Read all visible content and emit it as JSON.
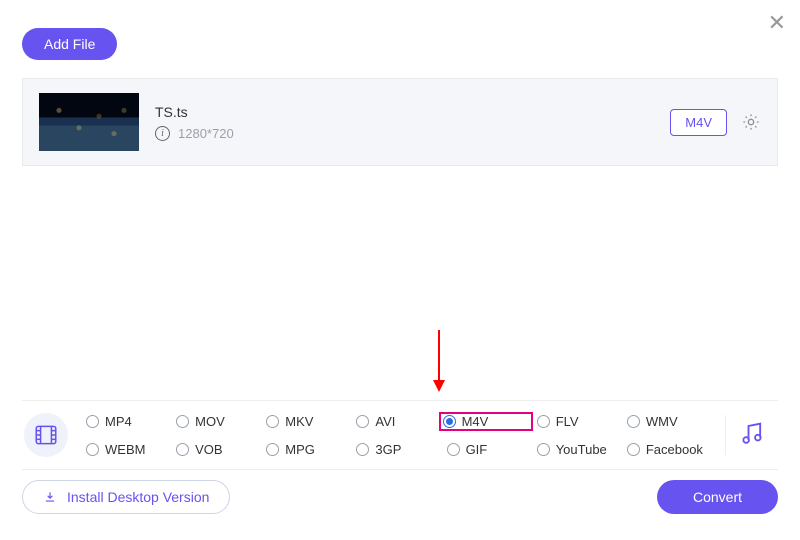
{
  "header": {
    "add_file_label": "Add File"
  },
  "file": {
    "name": "TS.ts",
    "resolution": "1280*720",
    "selected_format": "M4V"
  },
  "formats": {
    "row1": [
      "MP4",
      "MOV",
      "MKV",
      "AVI",
      "M4V",
      "FLV",
      "WMV"
    ],
    "row2": [
      "WEBM",
      "VOB",
      "MPG",
      "3GP",
      "GIF",
      "YouTube",
      "Facebook"
    ],
    "selected": "M4V"
  },
  "footer": {
    "install_label": "Install Desktop Version",
    "convert_label": "Convert"
  },
  "annotation": {
    "highlight_target": "M4V"
  }
}
